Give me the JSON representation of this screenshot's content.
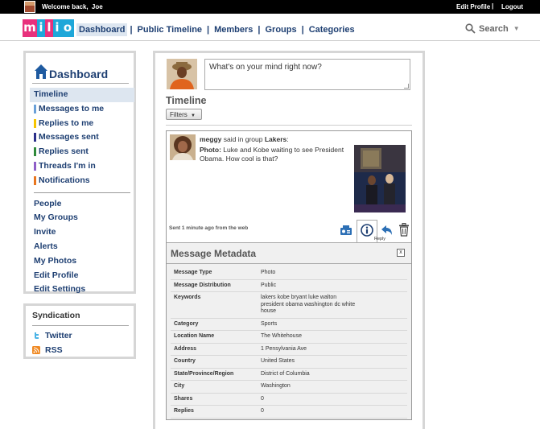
{
  "topbar": {
    "welcome": "Welcome back,",
    "username": "Joe",
    "edit_profile": "Edit Profile",
    "separator": "|",
    "logout": "Logout"
  },
  "logo": {
    "letters": [
      "m",
      "i",
      "l",
      "i",
      "o"
    ],
    "colors": [
      "#e8317c",
      "#1ea7d9"
    ]
  },
  "nav": {
    "items": [
      "Dashboard",
      "Public Timeline",
      "Members",
      "Groups",
      "Categories"
    ],
    "active": "Dashboard",
    "separator": "|"
  },
  "search": {
    "label": "Search",
    "icon": "magnifier-icon"
  },
  "sidebar": {
    "title": "Dashboard",
    "items": [
      {
        "label": "Timeline",
        "color": ""
      },
      {
        "label": "Messages to me",
        "color": "#6aa0d8"
      },
      {
        "label": "Replies to me",
        "color": "#f5c400"
      },
      {
        "label": "Messages sent",
        "color": "#2b2f8a"
      },
      {
        "label": "Replies sent",
        "color": "#2f8a3a"
      },
      {
        "label": "Threads I'm in",
        "color": "#8f5fc8"
      },
      {
        "label": "Notifications",
        "color": "#e8761f"
      }
    ],
    "items2": [
      "People",
      "My Groups",
      "Invite",
      "Alerts",
      "My Photos",
      "Edit Profile",
      "Edit Settings"
    ]
  },
  "syndication": {
    "title": "Syndication",
    "items": [
      {
        "label": "Twitter",
        "icon": "twitter-icon"
      },
      {
        "label": "RSS",
        "icon": "rss-icon"
      }
    ]
  },
  "status": {
    "placeholder": "What's on your mind right now?"
  },
  "timeline": {
    "title": "Timeline",
    "filters": "Filters",
    "filters_caret": "▼"
  },
  "message": {
    "user": "meggy",
    "said_in": "said in group",
    "group": "Lakers",
    "colon": ":",
    "type_label": "Photo:",
    "text": "Luke and Kobe waiting to see President Obama. How cool is that?",
    "sent": "Sent 1 minute ago from the web",
    "reply": "Reply"
  },
  "metadata": {
    "title": "Message Metadata",
    "close": "x",
    "rows": [
      {
        "k": "Message Type",
        "v": "Photo"
      },
      {
        "k": "Message Distribution",
        "v": "Public"
      },
      {
        "k": "Keywords",
        "v": "lakers kobe bryant luke walton president obama washington dc white house"
      },
      {
        "k": "Category",
        "v": "Sports"
      },
      {
        "k": "Location Name",
        "v": "The Whitehouse"
      },
      {
        "k": "Address",
        "v": "1 Pensylvania Ave"
      },
      {
        "k": "Country",
        "v": "United States"
      },
      {
        "k": "State/Province/Region",
        "v": "District of Columbia"
      },
      {
        "k": "City",
        "v": "Washington"
      },
      {
        "k": "Shares",
        "v": "0"
      },
      {
        "k": "Replies",
        "v": "0"
      }
    ]
  }
}
